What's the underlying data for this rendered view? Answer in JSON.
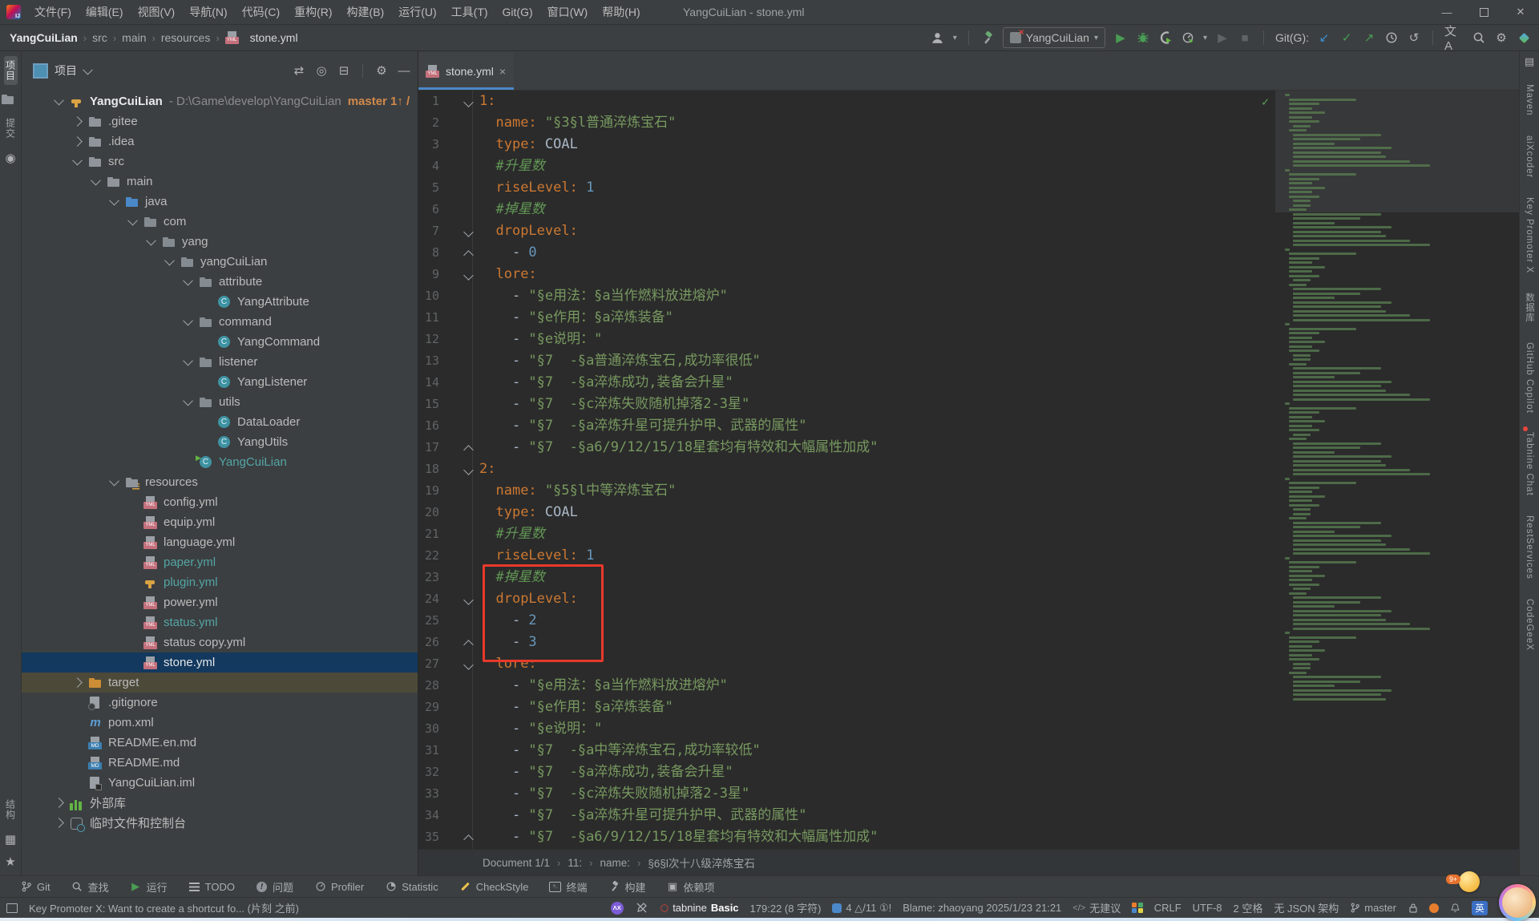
{
  "title_bar": {
    "app_title": "YangCuiLian - stone.yml",
    "menus": [
      "文件(F)",
      "编辑(E)",
      "视图(V)",
      "导航(N)",
      "代码(C)",
      "重构(R)",
      "构建(B)",
      "运行(U)",
      "工具(T)",
      "Git(G)",
      "窗口(W)",
      "帮助(H)"
    ]
  },
  "nav_bar": {
    "breadcrumbs": [
      "YangCuiLian",
      "src",
      "main",
      "resources"
    ],
    "file_crumb": "stone.yml",
    "run_config": "YangCuiLian",
    "git_label": "Git(G):"
  },
  "left_stripe": {
    "top": [
      {
        "kind": "tab",
        "label": "项目",
        "active": true
      },
      {
        "kind": "icon",
        "icon": "folder-icon"
      },
      {
        "kind": "tab",
        "label": "提交"
      },
      {
        "kind": "icon",
        "icon": "commit-icon"
      }
    ],
    "bottom": [
      {
        "kind": "tab",
        "label": "结构"
      },
      {
        "kind": "icon",
        "icon": "structure-grid-icon"
      },
      {
        "kind": "icon",
        "icon": "star-icon"
      }
    ]
  },
  "project_panel": {
    "title": "项目",
    "tree": [
      {
        "v": 0,
        "c": "v",
        "i": "plugin-project-icon",
        "l": "YangCuiLian",
        "f": "bold",
        "path": " - D:\\Game\\develop\\YangCuiLian",
        "branch": "master 1↑ /"
      },
      {
        "v": 1,
        "c": ">",
        "i": "folder-icon",
        "l": ".gitee"
      },
      {
        "v": 1,
        "c": ">",
        "i": "folder-icon",
        "l": ".idea"
      },
      {
        "v": 1,
        "c": "v",
        "i": "folder-icon",
        "l": "src"
      },
      {
        "v": 2,
        "c": "v",
        "i": "folder-icon",
        "l": "main"
      },
      {
        "v": 3,
        "c": "v",
        "i": "source-folder-icon",
        "l": "java"
      },
      {
        "v": 4,
        "c": "v",
        "i": "package-icon",
        "l": "com"
      },
      {
        "v": 5,
        "c": "v",
        "i": "package-icon",
        "l": "yang"
      },
      {
        "v": 6,
        "c": "v",
        "i": "package-icon",
        "l": "yangCuiLian"
      },
      {
        "v": 7,
        "c": "v",
        "i": "package-icon",
        "l": "attribute"
      },
      {
        "v": 8,
        "c": "",
        "i": "class-icon",
        "l": "YangAttribute"
      },
      {
        "v": 7,
        "c": "v",
        "i": "package-icon",
        "l": "command"
      },
      {
        "v": 8,
        "c": "",
        "i": "class-icon",
        "l": "YangCommand"
      },
      {
        "v": 7,
        "c": "v",
        "i": "package-icon",
        "l": "listener"
      },
      {
        "v": 8,
        "c": "",
        "i": "class-icon",
        "l": "YangListener"
      },
      {
        "v": 7,
        "c": "v",
        "i": "package-icon",
        "l": "utils"
      },
      {
        "v": 8,
        "c": "",
        "i": "class-icon",
        "l": "DataLoader"
      },
      {
        "v": 8,
        "c": "",
        "i": "class-icon",
        "l": "YangUtils"
      },
      {
        "v": 7,
        "c": "",
        "i": "main-class-icon",
        "l": "YangCuiLian",
        "f": "teal"
      },
      {
        "v": 3,
        "c": "v",
        "i": "resources-folder-icon",
        "l": "resources"
      },
      {
        "v": 4,
        "c": "",
        "i": "yaml-file-icon",
        "l": "config.yml"
      },
      {
        "v": 4,
        "c": "",
        "i": "yaml-file-icon",
        "l": "equip.yml"
      },
      {
        "v": 4,
        "c": "",
        "i": "yaml-file-icon",
        "l": "language.yml"
      },
      {
        "v": 4,
        "c": "",
        "i": "yaml-file-icon",
        "l": "paper.yml",
        "f": "teal"
      },
      {
        "v": 4,
        "c": "",
        "i": "plugin-yml-icon",
        "l": "plugin.yml",
        "f": "teal"
      },
      {
        "v": 4,
        "c": "",
        "i": "yaml-file-icon",
        "l": "power.yml"
      },
      {
        "v": 4,
        "c": "",
        "i": "yaml-file-icon",
        "l": "status.yml",
        "f": "teal"
      },
      {
        "v": 4,
        "c": "",
        "i": "yaml-file-icon",
        "l": "status copy.yml"
      },
      {
        "v": 4,
        "c": "",
        "i": "yaml-file-icon",
        "l": "stone.yml",
        "f": "white",
        "r": "selected"
      },
      {
        "v": 1,
        "c": ">",
        "i": "excluded-folder-icon",
        "l": "target",
        "r": "olive"
      },
      {
        "v": 1,
        "c": "",
        "i": "ignore-file-icon",
        "l": ".gitignore"
      },
      {
        "v": 1,
        "c": "",
        "i": "maven-icon",
        "l": "pom.xml"
      },
      {
        "v": 1,
        "c": "",
        "i": "markdown-icon",
        "l": "README.en.md"
      },
      {
        "v": 1,
        "c": "",
        "i": "markdown-icon",
        "l": "README.md"
      },
      {
        "v": 1,
        "c": "",
        "i": "iml-file-icon",
        "l": "YangCuiLian.iml"
      },
      {
        "v": 0,
        "c": ">",
        "i": "libraries-icon",
        "l": "外部库"
      },
      {
        "v": 0,
        "c": ">",
        "i": "console-icon",
        "l": "临时文件和控制台"
      }
    ]
  },
  "editor": {
    "tab_label": "stone.yml",
    "annotation_box": {
      "from_line": 23,
      "to_line": 26
    },
    "lines": [
      {
        "n": 1,
        "f": "o",
        "t": [
          [
            "k",
            "1:"
          ]
        ]
      },
      {
        "n": 2,
        "t": [
          [
            "p",
            "  "
          ],
          [
            "k",
            "name:"
          ],
          [
            "p",
            " "
          ],
          [
            "s",
            "\"§3§l普通淬炼宝石\""
          ]
        ]
      },
      {
        "n": 3,
        "t": [
          [
            "p",
            "  "
          ],
          [
            "k",
            "type:"
          ],
          [
            "p",
            " COAL"
          ]
        ]
      },
      {
        "n": 4,
        "t": [
          [
            "p",
            "  "
          ],
          [
            "c",
            "#升星数"
          ]
        ]
      },
      {
        "n": 5,
        "t": [
          [
            "p",
            "  "
          ],
          [
            "k",
            "riseLevel:"
          ],
          [
            "p",
            " "
          ],
          [
            "n2",
            "1"
          ]
        ]
      },
      {
        "n": 6,
        "t": [
          [
            "p",
            "  "
          ],
          [
            "c",
            "#掉星数"
          ]
        ]
      },
      {
        "n": 7,
        "f": "o",
        "t": [
          [
            "p",
            "  "
          ],
          [
            "k",
            "dropLevel:"
          ]
        ]
      },
      {
        "n": 8,
        "f": "c",
        "t": [
          [
            "p",
            "    - "
          ],
          [
            "n2",
            "0"
          ]
        ]
      },
      {
        "n": 9,
        "f": "o",
        "t": [
          [
            "p",
            "  "
          ],
          [
            "k",
            "lore:"
          ]
        ]
      },
      {
        "n": 10,
        "t": [
          [
            "p",
            "    - "
          ],
          [
            "s",
            "\"§e用法：§a当作燃料放进熔炉\""
          ]
        ]
      },
      {
        "n": 11,
        "t": [
          [
            "p",
            "    - "
          ],
          [
            "s",
            "\"§e作用：§a淬炼装备\""
          ]
        ]
      },
      {
        "n": 12,
        "t": [
          [
            "p",
            "    - "
          ],
          [
            "s",
            "\"§e说明：\""
          ]
        ]
      },
      {
        "n": 13,
        "t": [
          [
            "p",
            "    - "
          ],
          [
            "s",
            "\"§7  -§a普通淬炼宝石,成功率很低\""
          ]
        ]
      },
      {
        "n": 14,
        "t": [
          [
            "p",
            "    - "
          ],
          [
            "s",
            "\"§7  -§a淬炼成功,装备会升星\""
          ]
        ]
      },
      {
        "n": 15,
        "t": [
          [
            "p",
            "    - "
          ],
          [
            "s",
            "\"§7  -§c淬炼失败随机掉落2-3星\""
          ]
        ]
      },
      {
        "n": 16,
        "t": [
          [
            "p",
            "    - "
          ],
          [
            "s",
            "\"§7  -§a淬炼升星可提升护甲、武器的属性\""
          ]
        ]
      },
      {
        "n": 17,
        "f": "c",
        "t": [
          [
            "p",
            "    - "
          ],
          [
            "s",
            "\"§7  -§a6/9/12/15/18星套均有特效和大幅属性加成\""
          ]
        ]
      },
      {
        "n": 18,
        "f": "o",
        "t": [
          [
            "k",
            "2:"
          ]
        ]
      },
      {
        "n": 19,
        "t": [
          [
            "p",
            "  "
          ],
          [
            "k",
            "name:"
          ],
          [
            "p",
            " "
          ],
          [
            "s",
            "\"§5§l中等淬炼宝石\""
          ]
        ]
      },
      {
        "n": 20,
        "t": [
          [
            "p",
            "  "
          ],
          [
            "k",
            "type:"
          ],
          [
            "p",
            " COAL"
          ]
        ]
      },
      {
        "n": 21,
        "t": [
          [
            "p",
            "  "
          ],
          [
            "c",
            "#升星数"
          ]
        ]
      },
      {
        "n": 22,
        "t": [
          [
            "p",
            "  "
          ],
          [
            "k",
            "riseLevel:"
          ],
          [
            "p",
            " "
          ],
          [
            "n2",
            "1"
          ]
        ]
      },
      {
        "n": 23,
        "t": [
          [
            "p",
            "  "
          ],
          [
            "c",
            "#掉星数"
          ]
        ]
      },
      {
        "n": 24,
        "f": "o",
        "t": [
          [
            "p",
            "  "
          ],
          [
            "k",
            "dropLevel:"
          ]
        ]
      },
      {
        "n": 25,
        "t": [
          [
            "p",
            "    - "
          ],
          [
            "n2",
            "2"
          ]
        ]
      },
      {
        "n": 26,
        "f": "c",
        "t": [
          [
            "p",
            "    - "
          ],
          [
            "n2",
            "3"
          ]
        ]
      },
      {
        "n": 27,
        "f": "o",
        "t": [
          [
            "p",
            "  "
          ],
          [
            "k",
            "lore:"
          ]
        ]
      },
      {
        "n": 28,
        "t": [
          [
            "p",
            "    - "
          ],
          [
            "s",
            "\"§e用法：§a当作燃料放进熔炉\""
          ]
        ]
      },
      {
        "n": 29,
        "t": [
          [
            "p",
            "    - "
          ],
          [
            "s",
            "\"§e作用：§a淬炼装备\""
          ]
        ]
      },
      {
        "n": 30,
        "t": [
          [
            "p",
            "    - "
          ],
          [
            "s",
            "\"§e说明：\""
          ]
        ]
      },
      {
        "n": 31,
        "t": [
          [
            "p",
            "    - "
          ],
          [
            "s",
            "\"§7  -§a中等淬炼宝石,成功率较低\""
          ]
        ]
      },
      {
        "n": 32,
        "t": [
          [
            "p",
            "    - "
          ],
          [
            "s",
            "\"§7  -§a淬炼成功,装备会升星\""
          ]
        ]
      },
      {
        "n": 33,
        "t": [
          [
            "p",
            "    - "
          ],
          [
            "s",
            "\"§7  -§c淬炼失败随机掉落2-3星\""
          ]
        ]
      },
      {
        "n": 34,
        "t": [
          [
            "p",
            "    - "
          ],
          [
            "s",
            "\"§7  -§a淬炼升星可提升护甲、武器的属性\""
          ]
        ]
      },
      {
        "n": 35,
        "f": "c",
        "t": [
          [
            "p",
            "    - "
          ],
          [
            "s",
            "\"§7  -§a6/9/12/15/18星套均有特效和大幅属性加成\""
          ]
        ]
      }
    ]
  },
  "doc_breadcrumb": [
    "Document 1/1",
    "11:",
    "name:",
    "§6§l次十八级淬炼宝石"
  ],
  "right_stripe": {
    "labels": [
      {
        "label": "Maven"
      },
      {
        "label": "aiXcoder"
      },
      {
        "label": "Key Promoter X"
      },
      {
        "label": "数据库"
      },
      {
        "label": "GitHub Copilot"
      },
      {
        "label": "Tabnine Chat",
        "dot": true
      },
      {
        "label": "RestServices"
      },
      {
        "label": "CodeGeeX"
      }
    ]
  },
  "bottom_toolbar": [
    {
      "icon": "git-branch-icon",
      "label": "Git"
    },
    {
      "icon": "search-icon",
      "label": "查找"
    },
    {
      "icon": "run-icon",
      "label": "运行"
    },
    {
      "icon": "todo-list-icon",
      "label": "TODO"
    },
    {
      "icon": "problems-icon",
      "label": "问题"
    },
    {
      "icon": "profiler-icon",
      "label": "Profiler"
    },
    {
      "icon": "statistic-icon",
      "label": "Statistic"
    },
    {
      "icon": "checkstyle-icon",
      "label": "CheckStyle"
    },
    {
      "icon": "terminal-icon",
      "label": "终端"
    },
    {
      "icon": "build-icon",
      "label": "构建"
    },
    {
      "icon": "dependencies-icon",
      "label": "依赖项"
    }
  ],
  "status_bar": {
    "message": "Key Promoter X: Want to create a shortcut fo... (片刻 之前)",
    "tabnine_label": "tabnine",
    "tabnine_plan": "Basic",
    "caret_position": "179:22 (8 字符)",
    "inspections": "4 △/11 ①!",
    "blame": "Blame: zhaoyang 2025/1/23 21:21",
    "ai_suggestion": "无建议",
    "line_ending": "CRLF",
    "encoding": "UTF-8",
    "indent": "2 空格",
    "schema": "无 JSON 架构",
    "branch": "master",
    "ime": "英",
    "overflow_badge": "9+"
  },
  "colors": {
    "selection_blue": "#13395E",
    "annotation_red": "#E8392B",
    "key_orange": "#CC7832",
    "string_green": "#77995F",
    "number_blue": "#6897BB",
    "comment_green": "#629755",
    "teal_file": "#53A5A5",
    "accent_blue": "#4A88C7"
  }
}
